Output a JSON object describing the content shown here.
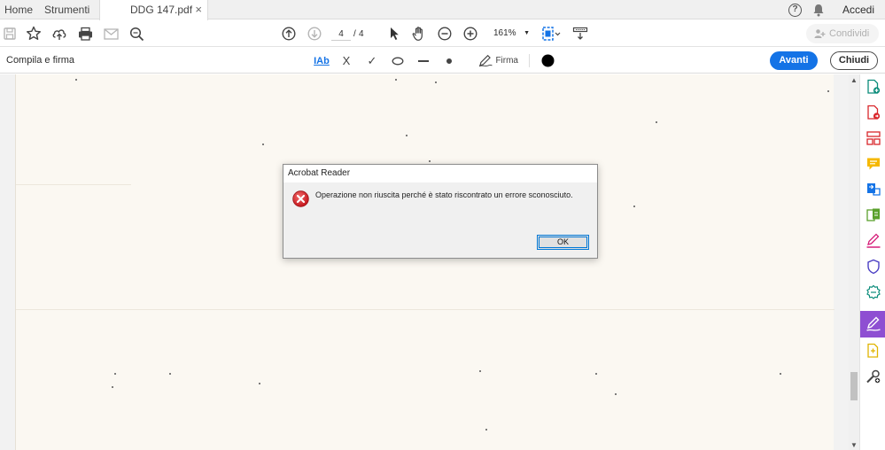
{
  "tabs": {
    "home": "Home",
    "tools": "Strumenti",
    "document": "DDG 147.pdf",
    "document_close": "×"
  },
  "topright": {
    "help_icon": "question-mark-icon",
    "help_glyph": "?",
    "notifications_icon": "bell-icon",
    "signin": "Accedi"
  },
  "toolbar": {
    "current_page": "4",
    "page_separator": "/",
    "total_pages": "4",
    "zoom": "161%",
    "share": "Condividi"
  },
  "signbar": {
    "title": "Compila e firma",
    "text_tool": "IAb",
    "cross_tool": "X",
    "check_tool": "✓",
    "sign_label": "Firma",
    "next": "Avanti",
    "close": "Chiudi"
  },
  "dialog": {
    "title": "Acrobat Reader",
    "message": "Operazione non riuscita perché è stato riscontrato un errore sconosciuto.",
    "ok": "OK"
  },
  "colors": {
    "accent_blue": "#1473e6",
    "active_tool": "#8e4fd2",
    "page_bg": "#fbf8f2",
    "error_red": "#d9262b"
  },
  "right_panel_tools": [
    "create-pdf-icon",
    "export-pdf-icon",
    "organize-pages-icon",
    "comment-icon",
    "send-for-comments-icon",
    "combine-files-icon",
    "request-signature-icon",
    "protect-icon",
    "scan-enhance-icon",
    "fill-sign-icon",
    "more-tools-icon",
    "customize-tools-icon"
  ]
}
